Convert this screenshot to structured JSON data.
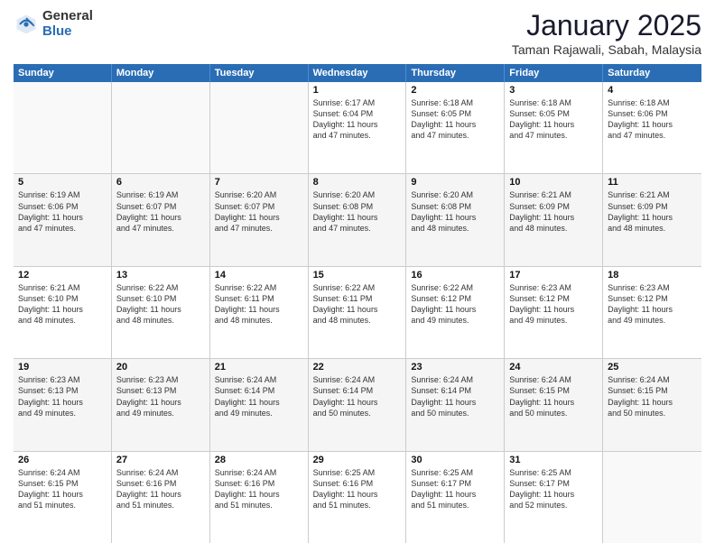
{
  "logo": {
    "general": "General",
    "blue": "Blue"
  },
  "title": "January 2025",
  "location": "Taman Rajawali, Sabah, Malaysia",
  "days_header": [
    "Sunday",
    "Monday",
    "Tuesday",
    "Wednesday",
    "Thursday",
    "Friday",
    "Saturday"
  ],
  "weeks": [
    [
      {
        "num": "",
        "lines": []
      },
      {
        "num": "",
        "lines": []
      },
      {
        "num": "",
        "lines": []
      },
      {
        "num": "1",
        "lines": [
          "Sunrise: 6:17 AM",
          "Sunset: 6:04 PM",
          "Daylight: 11 hours",
          "and 47 minutes."
        ]
      },
      {
        "num": "2",
        "lines": [
          "Sunrise: 6:18 AM",
          "Sunset: 6:05 PM",
          "Daylight: 11 hours",
          "and 47 minutes."
        ]
      },
      {
        "num": "3",
        "lines": [
          "Sunrise: 6:18 AM",
          "Sunset: 6:05 PM",
          "Daylight: 11 hours",
          "and 47 minutes."
        ]
      },
      {
        "num": "4",
        "lines": [
          "Sunrise: 6:18 AM",
          "Sunset: 6:06 PM",
          "Daylight: 11 hours",
          "and 47 minutes."
        ]
      }
    ],
    [
      {
        "num": "5",
        "lines": [
          "Sunrise: 6:19 AM",
          "Sunset: 6:06 PM",
          "Daylight: 11 hours",
          "and 47 minutes."
        ]
      },
      {
        "num": "6",
        "lines": [
          "Sunrise: 6:19 AM",
          "Sunset: 6:07 PM",
          "Daylight: 11 hours",
          "and 47 minutes."
        ]
      },
      {
        "num": "7",
        "lines": [
          "Sunrise: 6:20 AM",
          "Sunset: 6:07 PM",
          "Daylight: 11 hours",
          "and 47 minutes."
        ]
      },
      {
        "num": "8",
        "lines": [
          "Sunrise: 6:20 AM",
          "Sunset: 6:08 PM",
          "Daylight: 11 hours",
          "and 47 minutes."
        ]
      },
      {
        "num": "9",
        "lines": [
          "Sunrise: 6:20 AM",
          "Sunset: 6:08 PM",
          "Daylight: 11 hours",
          "and 48 minutes."
        ]
      },
      {
        "num": "10",
        "lines": [
          "Sunrise: 6:21 AM",
          "Sunset: 6:09 PM",
          "Daylight: 11 hours",
          "and 48 minutes."
        ]
      },
      {
        "num": "11",
        "lines": [
          "Sunrise: 6:21 AM",
          "Sunset: 6:09 PM",
          "Daylight: 11 hours",
          "and 48 minutes."
        ]
      }
    ],
    [
      {
        "num": "12",
        "lines": [
          "Sunrise: 6:21 AM",
          "Sunset: 6:10 PM",
          "Daylight: 11 hours",
          "and 48 minutes."
        ]
      },
      {
        "num": "13",
        "lines": [
          "Sunrise: 6:22 AM",
          "Sunset: 6:10 PM",
          "Daylight: 11 hours",
          "and 48 minutes."
        ]
      },
      {
        "num": "14",
        "lines": [
          "Sunrise: 6:22 AM",
          "Sunset: 6:11 PM",
          "Daylight: 11 hours",
          "and 48 minutes."
        ]
      },
      {
        "num": "15",
        "lines": [
          "Sunrise: 6:22 AM",
          "Sunset: 6:11 PM",
          "Daylight: 11 hours",
          "and 48 minutes."
        ]
      },
      {
        "num": "16",
        "lines": [
          "Sunrise: 6:22 AM",
          "Sunset: 6:12 PM",
          "Daylight: 11 hours",
          "and 49 minutes."
        ]
      },
      {
        "num": "17",
        "lines": [
          "Sunrise: 6:23 AM",
          "Sunset: 6:12 PM",
          "Daylight: 11 hours",
          "and 49 minutes."
        ]
      },
      {
        "num": "18",
        "lines": [
          "Sunrise: 6:23 AM",
          "Sunset: 6:12 PM",
          "Daylight: 11 hours",
          "and 49 minutes."
        ]
      }
    ],
    [
      {
        "num": "19",
        "lines": [
          "Sunrise: 6:23 AM",
          "Sunset: 6:13 PM",
          "Daylight: 11 hours",
          "and 49 minutes."
        ]
      },
      {
        "num": "20",
        "lines": [
          "Sunrise: 6:23 AM",
          "Sunset: 6:13 PM",
          "Daylight: 11 hours",
          "and 49 minutes."
        ]
      },
      {
        "num": "21",
        "lines": [
          "Sunrise: 6:24 AM",
          "Sunset: 6:14 PM",
          "Daylight: 11 hours",
          "and 49 minutes."
        ]
      },
      {
        "num": "22",
        "lines": [
          "Sunrise: 6:24 AM",
          "Sunset: 6:14 PM",
          "Daylight: 11 hours",
          "and 50 minutes."
        ]
      },
      {
        "num": "23",
        "lines": [
          "Sunrise: 6:24 AM",
          "Sunset: 6:14 PM",
          "Daylight: 11 hours",
          "and 50 minutes."
        ]
      },
      {
        "num": "24",
        "lines": [
          "Sunrise: 6:24 AM",
          "Sunset: 6:15 PM",
          "Daylight: 11 hours",
          "and 50 minutes."
        ]
      },
      {
        "num": "25",
        "lines": [
          "Sunrise: 6:24 AM",
          "Sunset: 6:15 PM",
          "Daylight: 11 hours",
          "and 50 minutes."
        ]
      }
    ],
    [
      {
        "num": "26",
        "lines": [
          "Sunrise: 6:24 AM",
          "Sunset: 6:15 PM",
          "Daylight: 11 hours",
          "and 51 minutes."
        ]
      },
      {
        "num": "27",
        "lines": [
          "Sunrise: 6:24 AM",
          "Sunset: 6:16 PM",
          "Daylight: 11 hours",
          "and 51 minutes."
        ]
      },
      {
        "num": "28",
        "lines": [
          "Sunrise: 6:24 AM",
          "Sunset: 6:16 PM",
          "Daylight: 11 hours",
          "and 51 minutes."
        ]
      },
      {
        "num": "29",
        "lines": [
          "Sunrise: 6:25 AM",
          "Sunset: 6:16 PM",
          "Daylight: 11 hours",
          "and 51 minutes."
        ]
      },
      {
        "num": "30",
        "lines": [
          "Sunrise: 6:25 AM",
          "Sunset: 6:17 PM",
          "Daylight: 11 hours",
          "and 51 minutes."
        ]
      },
      {
        "num": "31",
        "lines": [
          "Sunrise: 6:25 AM",
          "Sunset: 6:17 PM",
          "Daylight: 11 hours",
          "and 52 minutes."
        ]
      },
      {
        "num": "",
        "lines": []
      }
    ]
  ]
}
